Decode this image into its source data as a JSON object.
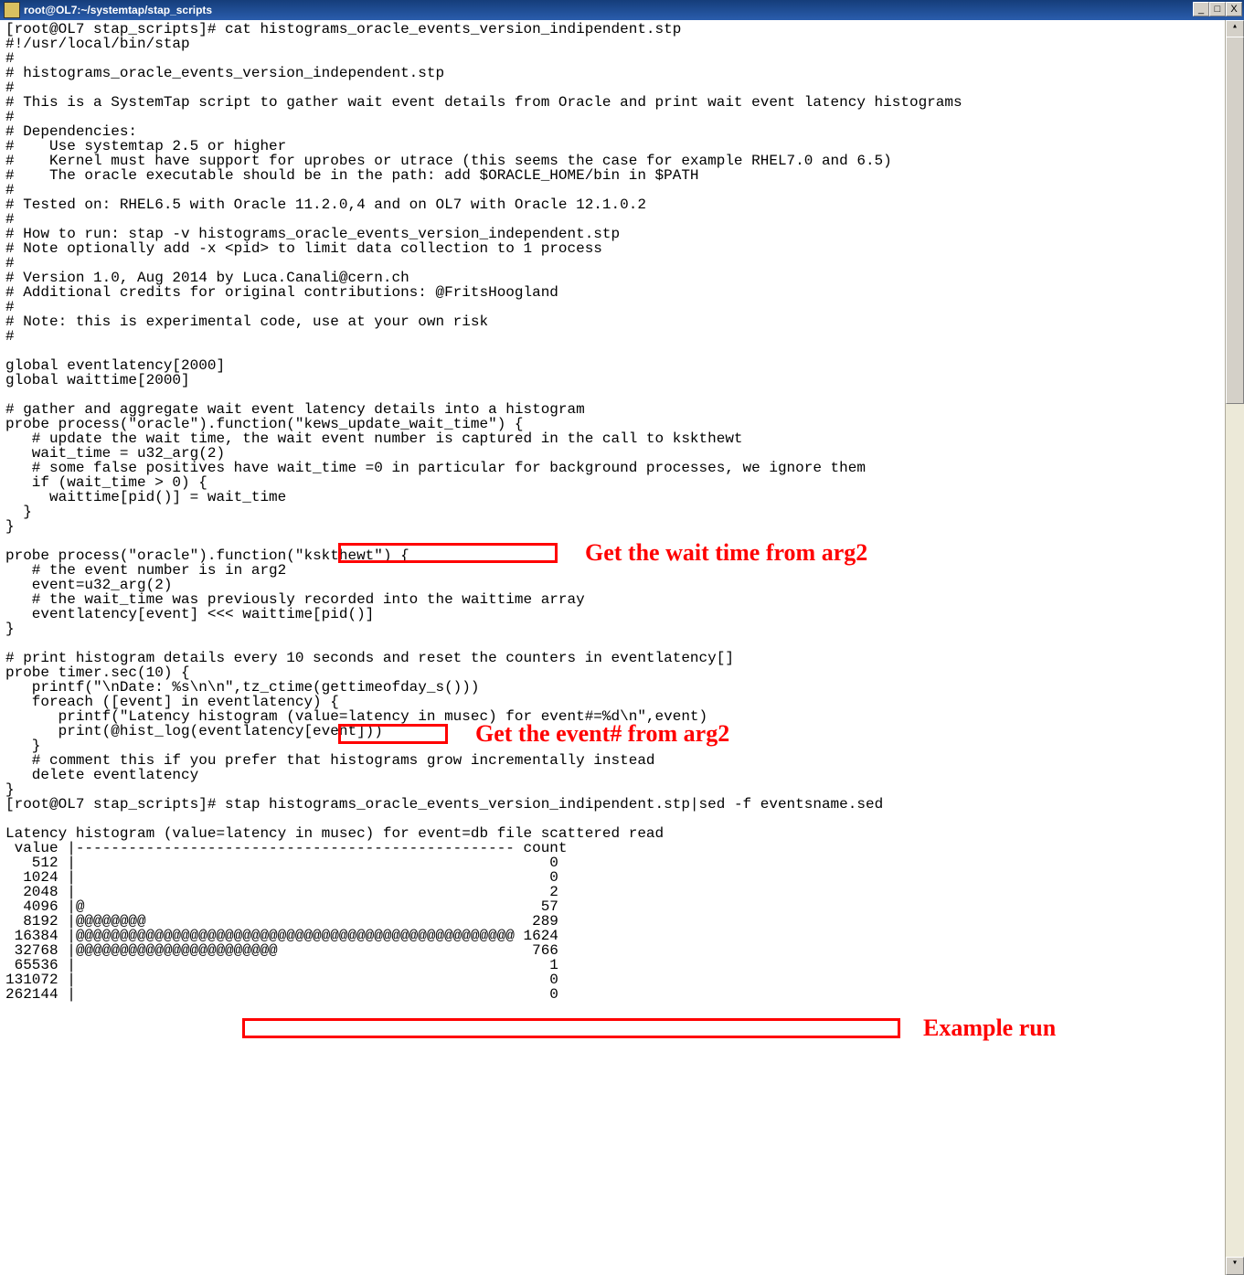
{
  "window": {
    "title": "root@OL7:~/systemtap/stap_scripts",
    "minimize": "_",
    "maximize": "□",
    "close": "X"
  },
  "prompt1": "[root@OL7 stap_scripts]# ",
  "cmd_cat": "cat histograms_oracle_events_version_indipendent.stp",
  "script": {
    "l01": "#!/usr/local/bin/stap",
    "l02": "#",
    "l03": "# histograms_oracle_events_version_independent.stp",
    "l04": "#",
    "l05": "# This is a SystemTap script to gather wait event details from Oracle and print wait event latency histograms",
    "l06": "#",
    "l07": "# Dependencies:",
    "l08": "#    Use systemtap 2.5 or higher",
    "l09": "#    Kernel must have support for uprobes or utrace (this seems the case for example RHEL7.0 and 6.5)",
    "l10": "#    The oracle executable should be in the path: add $ORACLE_HOME/bin in $PATH",
    "l11": "#",
    "l12": "# Tested on: RHEL6.5 with Oracle 11.2.0,4 and on OL7 with Oracle 12.1.0.2",
    "l13": "#",
    "l14": "# How to run: stap -v histograms_oracle_events_version_independent.stp",
    "l15": "# Note optionally add -x <pid> to limit data collection to 1 process",
    "l16": "#",
    "l17": "# Version 1.0, Aug 2014 by Luca.Canali@cern.ch",
    "l18": "# Additional credits for original contributions: @FritsHoogland",
    "l19": "#",
    "l20": "# Note: this is experimental code, use at your own risk",
    "l21": "#",
    "l22": "",
    "l23": "global eventlatency[2000]",
    "l24": "global waittime[2000]",
    "l25": "",
    "l26": "# gather and aggregate wait event latency details into a histogram",
    "p1a": "probe process(\"oracle\").function(",
    "p1b": "\"kews_update_wait_time\")",
    "p1c": " {",
    "l28": "   # update the wait time, the wait event number is captured in the call to kskthewt",
    "l29": "   wait_time = u32_arg(2)",
    "l30": "   # some false positives have wait_time =0 in particular for background processes, we ignore them",
    "l31": "   if (wait_time > 0) {",
    "l32": "     waittime[pid()] = wait_time",
    "l33": "  }",
    "l34": "}",
    "l35": "",
    "p2a": "probe process(\"oracle\").function(",
    "p2b": "\"kskthewt\")",
    "p2c": " {",
    "l37": "   # the event number is in arg2",
    "l38": "   event=u32_arg(2)",
    "l39": "   # the wait_time was previously recorded into the waittime array",
    "l40": "   eventlatency[event] <<< waittime[pid()]",
    "l41": "}",
    "l42": "",
    "l43": "# print histogram details every 10 seconds and reset the counters in eventlatency[]",
    "l44": "probe timer.sec(10) {",
    "l45": "   printf(\"\\nDate: %s\\n\\n\",tz_ctime(gettimeofday_s()))",
    "l46": "   foreach ([event] in eventlatency) {",
    "l47": "      printf(\"Latency histogram (value=latency in musec) for event#=%d\\n\",event)",
    "l48": "      print(@hist_log(eventlatency[event]))",
    "l49": "   }",
    "l50": "   # comment this if you prefer that histograms grow incrementally instead",
    "l51": "   delete eventlatency",
    "l52": "}"
  },
  "prompt2": "[root@OL7 stap_scripts]# ",
  "cmd_run": "stap histograms_oracle_events_version_indipendent.stp|sed -f eventsname.sed",
  "hist_title": "Latency histogram (value=latency in musec) for event=db file scattered read",
  "hist_header": " value |-------------------------------------------------- count",
  "histogram": [
    {
      "value": "   512",
      "bar": "",
      "count": "   0"
    },
    {
      "value": "  1024",
      "bar": "",
      "count": "   0"
    },
    {
      "value": "  2048",
      "bar": "",
      "count": "   2"
    },
    {
      "value": "  4096",
      "bar": "@",
      "count": "  57"
    },
    {
      "value": "  8192",
      "bar": "@@@@@@@@",
      "count": " 289"
    },
    {
      "value": " 16384",
      "bar": "@@@@@@@@@@@@@@@@@@@@@@@@@@@@@@@@@@@@@@@@@@@@@@@@@@",
      "count": "1624"
    },
    {
      "value": " 32768",
      "bar": "@@@@@@@@@@@@@@@@@@@@@@@",
      "count": " 766"
    },
    {
      "value": " 65536",
      "bar": "",
      "count": "   1"
    },
    {
      "value": "131072",
      "bar": "",
      "count": "   0"
    },
    {
      "value": "262144",
      "bar": "",
      "count": "   0"
    }
  ],
  "annotations": {
    "a1": "Get the wait time from arg2",
    "a2": "Get the event# from arg2",
    "a3": "Example run"
  }
}
